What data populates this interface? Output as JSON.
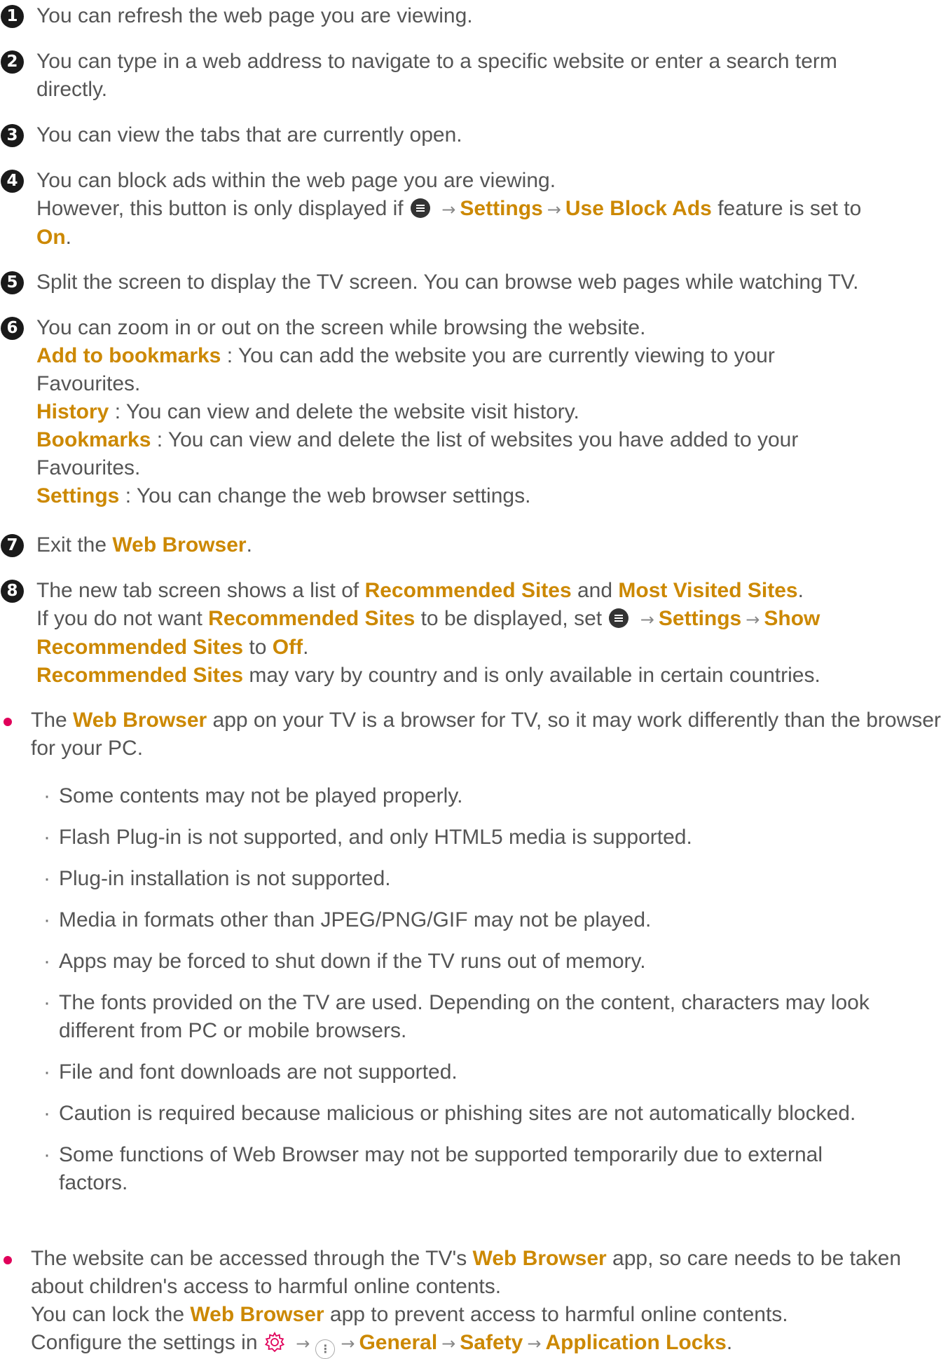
{
  "items": {
    "i1": {
      "num": "1",
      "text": "You can refresh the web page you are viewing."
    },
    "i2": {
      "num": "2",
      "text": "You can type in a web address to navigate to a specific website or enter a search term directly."
    },
    "i3": {
      "num": "3",
      "text": "You can view the tabs that are currently open."
    },
    "i4": {
      "num": "4",
      "line1": "You can block ads within the web page you are viewing.",
      "p1": "However, this button is only displayed if",
      "settings": "Settings",
      "use_block_ads": "Use Block Ads",
      "p2": "feature is set to",
      "on": "On",
      "end": "."
    },
    "i5": {
      "num": "5",
      "text": "Split the screen to display the TV screen. You can browse web pages while watching TV."
    },
    "i6": {
      "num": "6",
      "line1": "You can zoom in or out on the screen while browsing the website.",
      "add_to_bookmarks": "Add to bookmarks",
      "add_desc": " : You can add the website you are currently viewing to your Favourites.",
      "history": "History",
      "history_desc": " : You can view and delete the website visit history.",
      "bookmarks": "Bookmarks",
      "bookmarks_desc": " : You can view and delete the list of websites you have added to your Favourites.",
      "settings": "Settings",
      "settings_desc": " : You can change the web browser settings."
    },
    "i7": {
      "num": "7",
      "p1": "Exit the ",
      "web_browser": "Web Browser",
      "end": "."
    },
    "i8": {
      "num": "8",
      "p1": "The new tab screen shows a list of ",
      "recommended_sites": "Recommended Sites",
      "and": " and ",
      "most_visited": "Most Visited Sites",
      "end": ".",
      "p2": "If you do not want ",
      "p3": " to be displayed, set",
      "settings": "Settings",
      "show_recommended": "Show Recommended Sites",
      "to": " to ",
      "off": "Off",
      "p4": " may vary by country and is only available in certain countries."
    }
  },
  "bullets": {
    "b1": {
      "p1": "The ",
      "web_browser": "Web Browser",
      "p2": " app on your TV is a browser for TV, so it may work differently than the browser for your PC."
    },
    "b2": {
      "p1": "The website can be accessed through the TV's ",
      "web_browser": "Web Browser",
      "p2": " app, so care needs to be taken about children's access to harmful online contents.",
      "p3": "You can lock the ",
      "p4": " app to prevent access to harmful online contents.",
      "p5": "Configure the settings in",
      "general": "General",
      "safety": "Safety",
      "app_locks": "Application Locks",
      "end": "."
    }
  },
  "sub_items": [
    "Some contents may not be played properly.",
    "Flash Plug-in is not supported, and only HTML5 media is supported.",
    "Plug-in installation is not supported.",
    "Media in formats other than JPEG/PNG/GIF may not be played.",
    "Apps may be forced to shut down if the TV runs out of memory.",
    "The fonts provided on the TV are used. Depending on the content, characters may look different from PC or mobile browsers.",
    "File and font downloads are not supported.",
    "Caution is required because malicious or phishing sites are not automatically blocked.",
    "Some functions of Web Browser may not be supported temporarily due to external factors."
  ],
  "glyphs": {
    "arrow": "→",
    "middot": "·",
    "dots": "⋮"
  },
  "colors": {
    "highlight": "#cc8800",
    "bullet": "#e0005a",
    "gear": "#e0005a"
  },
  "icons": [
    "menu-icon",
    "settings-gear-icon",
    "more-options-icon"
  ]
}
